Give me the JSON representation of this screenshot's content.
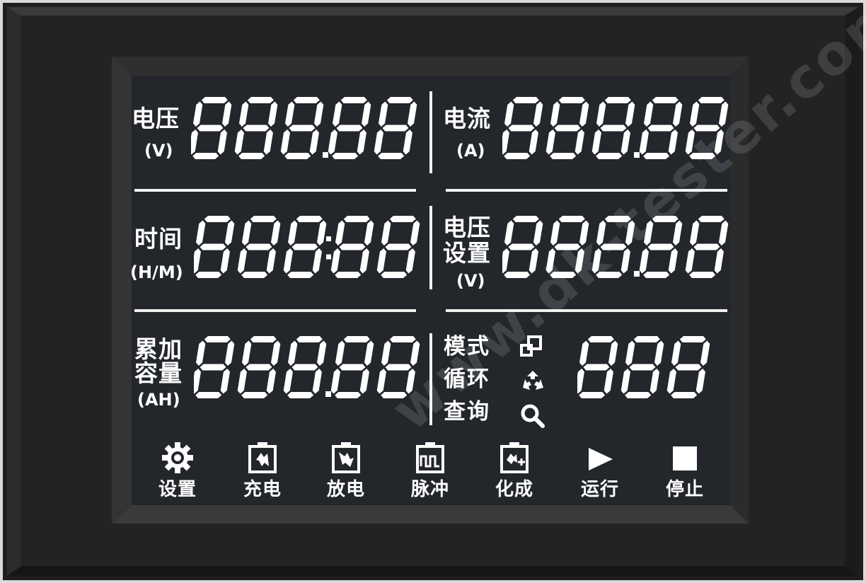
{
  "panel": {
    "voltage": {
      "label": "电压",
      "unit": "(V)",
      "digits": "888",
      "decimals": "88"
    },
    "current": {
      "label": "电流",
      "unit": "(A)",
      "digits": "888",
      "decimals": "88"
    },
    "time": {
      "label": "时间",
      "unit": "(H/M)",
      "digits": "888",
      "decimals": "88"
    },
    "voltage_setting": {
      "label_line1": "电压",
      "label_line2": "设置",
      "unit": "(V)",
      "digits": "888",
      "decimals": "88"
    },
    "capacity": {
      "label_line1": "累加",
      "label_line2": "容量",
      "unit": "(AH)",
      "digits": "888",
      "decimals": "88"
    },
    "status": {
      "mode": "模式",
      "cycle": "循环",
      "query": "查询",
      "digits": "888"
    }
  },
  "buttons": {
    "settings": "设置",
    "charge": "充电",
    "discharge": "放电",
    "pulse": "脉冲",
    "formation": "化成",
    "run": "运行",
    "stop": "停止"
  },
  "watermark": "www.dk-tester.com",
  "colors": {
    "lcd_background": "#23262b",
    "segment": "#ffffff",
    "bezel": "#222222"
  }
}
